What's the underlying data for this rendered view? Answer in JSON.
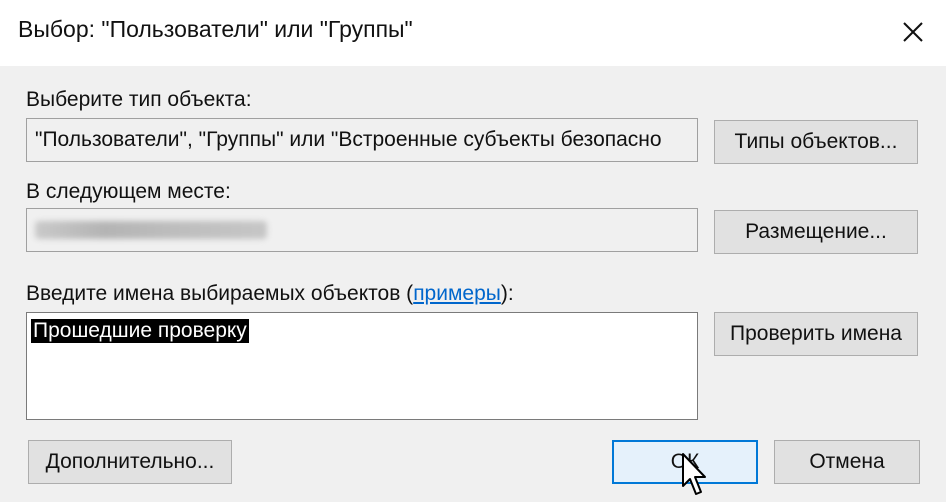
{
  "window": {
    "title": "Выбор: \"Пользователи\" или \"Группы\"",
    "close_icon": "close-icon"
  },
  "object_type": {
    "label": "Выберите тип объекта:",
    "value": "\"Пользователи\", \"Группы\" или \"Встроенные субъекты безопасно",
    "button": "Типы объектов..."
  },
  "location": {
    "label": "В следующем месте:",
    "value_redacted": true,
    "button": "Размещение..."
  },
  "names": {
    "label_prefix": "Введите имена выбираемых объектов (",
    "label_link": "примеры",
    "label_suffix": "):",
    "value": "Прошедшие проверку",
    "button": "Проверить имена"
  },
  "footer": {
    "advanced_button": "Дополнительно...",
    "ok_button": "ОК",
    "cancel_button": "Отмена"
  },
  "colors": {
    "accent": "#0078d7",
    "link": "#0066cc",
    "dialog_bg": "#f0f0f0",
    "button_bg": "#e1e1e1"
  }
}
